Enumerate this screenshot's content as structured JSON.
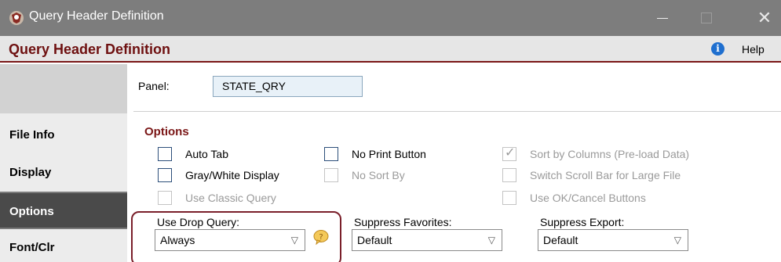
{
  "window": {
    "title": "Query Header Definition"
  },
  "header": {
    "title": "Query Header Definition",
    "help_label": "Help"
  },
  "sidebar": {
    "items": [
      {
        "label": "File Info"
      },
      {
        "label": "Display"
      },
      {
        "label": "Options",
        "active": true
      },
      {
        "label": "Font/Clr"
      }
    ]
  },
  "panel": {
    "label": "Panel:",
    "value": "STATE_QRY"
  },
  "options": {
    "title": "Options",
    "checkboxes": [
      {
        "label": "Auto Tab",
        "checked": false,
        "enabled": true
      },
      {
        "label": "Gray/White Display",
        "checked": false,
        "enabled": true
      },
      {
        "label": "Use Classic Query",
        "checked": false,
        "enabled": false
      },
      {
        "label": "No Print Button",
        "checked": false,
        "enabled": true
      },
      {
        "label": "No Sort By",
        "checked": false,
        "enabled": false
      },
      {
        "label": "Sort by Columns (Pre-load Data)",
        "checked": true,
        "enabled": false
      },
      {
        "label": "Switch Scroll Bar for Large File",
        "checked": false,
        "enabled": false
      },
      {
        "label": "Use OK/Cancel Buttons",
        "checked": false,
        "enabled": false
      }
    ]
  },
  "dropdowns": {
    "drop_query": {
      "label": "Use Drop Query:",
      "value": "Always"
    },
    "suppress_favorites": {
      "label": "Suppress Favorites:",
      "value": "Default"
    },
    "suppress_export": {
      "label": "Suppress Export:",
      "value": "Default"
    }
  },
  "colors": {
    "accent": "#7a1616",
    "titlebar": "#7d7d7d",
    "active_tab": "#4a4a4a"
  }
}
